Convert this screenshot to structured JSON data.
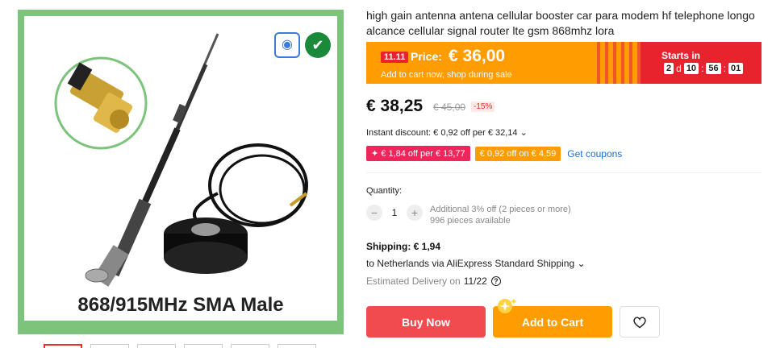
{
  "product": {
    "title": "high gain antenna antena cellular booster car para modem hf telephone longo alcance cellular signal router lte gsm 868mhz lora",
    "image_caption": "868/915MHz SMA Male"
  },
  "promo": {
    "badge": "11.11",
    "price_label": "Price:",
    "price_value": "€ 36,00",
    "subtitle": "Add to cart now, shop during sale",
    "starts_label": "Starts in",
    "timer": {
      "days": "2",
      "d_label": "d",
      "hours": "10",
      "minutes": "56",
      "seconds": "01"
    }
  },
  "pricing": {
    "current": "€ 38,25",
    "original": "€ 45,00",
    "discount": "-15%",
    "instant_discount": "Instant discount: € 0,92 off per € 32,14 ⌄"
  },
  "coupons": {
    "items": [
      "✦ € 1,84 off per € 13,77",
      "€ 0,92 off on € 4,59"
    ],
    "get_label": "Get coupons"
  },
  "quantity": {
    "label": "Quantity:",
    "value": "1",
    "minus": "−",
    "plus": "+",
    "additional": "Additional 3% off (2 pieces or more)",
    "available": "996 pieces available"
  },
  "shipping": {
    "cost": "Shipping: € 1,94",
    "destination": "to Netherlands via AliExpress Standard Shipping ⌄",
    "delivery_label": "Estimated Delivery on",
    "delivery_date": "11/22",
    "help_glyph": "?"
  },
  "actions": {
    "buy_now": "Buy Now",
    "add_to_cart": "Add to Cart"
  },
  "colors": {
    "accent_red": "#f14b50",
    "accent_orange": "#ff9c00",
    "link_blue": "#1a70d8"
  }
}
